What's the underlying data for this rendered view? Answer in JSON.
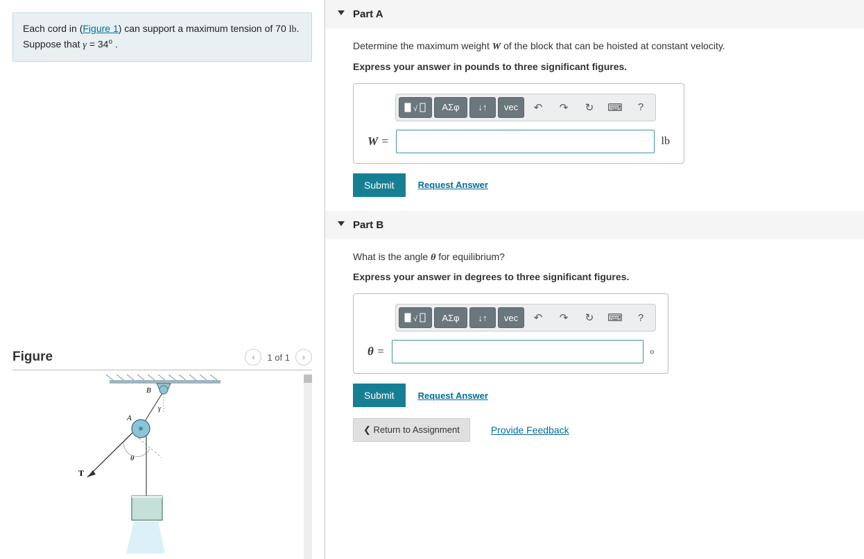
{
  "problem": {
    "prefix": "Each cord in (",
    "figure_link": "Figure 1",
    "suffix_before_tension": ") can support a maximum tension of 70 ",
    "tension_unit": "lb",
    "suffix_after_tension": ".",
    "line2_prefix": "Suppose that ",
    "gamma": "γ",
    "equals": " = 34",
    "degree": "o",
    "line2_suffix": " ."
  },
  "figure": {
    "title": "Figure",
    "pager": "1 of 1",
    "labels": {
      "B": "B",
      "A": "A",
      "gamma": "γ",
      "theta": "θ",
      "T": "T"
    }
  },
  "partA": {
    "title": "Part A",
    "q_before_W": "Determine the maximum weight ",
    "W": "W",
    "q_after_W": " of the block that can be hoisted at constant velocity.",
    "instruction": "Express your answer in pounds to three significant figures.",
    "var": "W",
    "unit": "lb",
    "submit": "Submit",
    "request": "Request Answer"
  },
  "partB": {
    "title": "Part B",
    "q_before_theta": "What is the angle ",
    "theta": "θ",
    "q_after_theta": " for equilibrium?",
    "instruction": "Express your answer in degrees to three significant figures.",
    "var": "θ",
    "unit": "o",
    "submit": "Submit",
    "request": "Request Answer"
  },
  "toolbar": {
    "greek": "ΑΣφ",
    "subscript": "↓↑",
    "vec": "vec",
    "undo": "↶",
    "redo": "↷",
    "reset": "↻",
    "keyboard": "⌨",
    "help": "?"
  },
  "bottom": {
    "return": "Return to Assignment",
    "feedback": "Provide Feedback"
  }
}
